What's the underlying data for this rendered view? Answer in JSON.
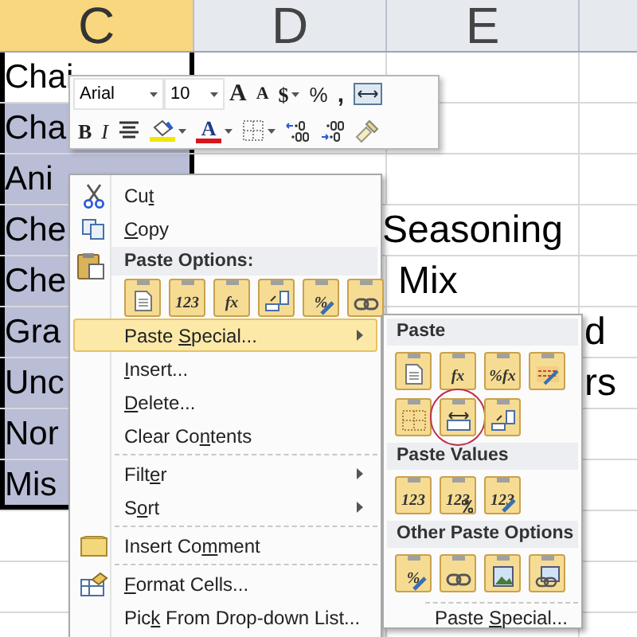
{
  "sheet": {
    "columns": [
      {
        "label": "C",
        "selected": true
      },
      {
        "label": "D",
        "selected": false
      },
      {
        "label": "E",
        "selected": false
      }
    ],
    "rows": [
      {
        "text": "Chai",
        "selected": false
      },
      {
        "text": "Cha",
        "selected": true
      },
      {
        "text": "Ani",
        "selected": true
      },
      {
        "text": "Che",
        "selected": true,
        "overflow": "Seasoning"
      },
      {
        "text": "Che",
        "selected": true,
        "overflow": "Mix"
      },
      {
        "text": "Gra",
        "selected": true,
        "overflow": "d"
      },
      {
        "text": "Unc",
        "selected": true,
        "overflow": "rs"
      },
      {
        "text": "Nor",
        "selected": true
      },
      {
        "text": "Mis",
        "selected": true
      }
    ]
  },
  "mini_toolbar": {
    "top_row": [
      {
        "kind": "font_field",
        "value": "Arial"
      },
      {
        "kind": "size_field",
        "value": "10"
      },
      {
        "kind": "grow",
        "glyph": "A"
      },
      {
        "kind": "shrink",
        "glyph": "A"
      },
      {
        "kind": "currency",
        "glyph": "$",
        "dropdown": true
      },
      {
        "kind": "percent",
        "glyph": "%"
      },
      {
        "kind": "comma",
        "glyph": ","
      },
      {
        "kind": "merge"
      }
    ],
    "bottom_row": [
      {
        "kind": "bold",
        "glyph": "B"
      },
      {
        "kind": "italic",
        "glyph": "I"
      },
      {
        "kind": "center"
      },
      {
        "kind": "fill",
        "color": "#f2e600",
        "dropdown": true
      },
      {
        "kind": "font_color",
        "glyph": "A",
        "color": "#d8141c",
        "dropdown": true
      },
      {
        "kind": "borders",
        "dropdown": true
      },
      {
        "kind": "inc_decimal"
      },
      {
        "kind": "dec_decimal"
      },
      {
        "kind": "painter"
      }
    ]
  },
  "context_menu": {
    "items": [
      {
        "kind": "item",
        "label": {
          "pre": "Cu",
          "key": "t"
        },
        "selected": false,
        "submenu": false
      },
      {
        "kind": "item",
        "label": {
          "key": "C",
          "post": "opy"
        },
        "selected": false,
        "submenu": false
      },
      {
        "kind": "header",
        "title": "Paste Options:"
      },
      {
        "kind": "icons",
        "icons": [
          {
            "kind": "page"
          },
          {
            "kind": "text",
            "glyph": "123"
          },
          {
            "kind": "text",
            "glyph": "fx"
          },
          {
            "kind": "transpose"
          },
          {
            "kind": "text_brush",
            "glyph": "%"
          },
          {
            "kind": "link"
          }
        ]
      },
      {
        "kind": "item",
        "label": {
          "pre": "Paste ",
          "key": "S",
          "post": "pecial..."
        },
        "selected": true,
        "submenu": true
      },
      {
        "kind": "item",
        "label": {
          "key": "I",
          "post": "nsert..."
        },
        "selected": false,
        "submenu": false
      },
      {
        "kind": "item",
        "label": {
          "key": "D",
          "post": "elete..."
        },
        "selected": false,
        "submenu": false
      },
      {
        "kind": "item",
        "label": {
          "pre": "Clear Co",
          "key": "n",
          "post": "tents"
        },
        "selected": false,
        "submenu": false
      },
      {
        "kind": "separator"
      },
      {
        "kind": "item",
        "label": {
          "pre": "Filt",
          "key": "e",
          "post": "r"
        },
        "selected": false,
        "submenu": true
      },
      {
        "kind": "item",
        "label": {
          "pre": "S",
          "key": "o",
          "post": "rt"
        },
        "selected": false,
        "submenu": true
      },
      {
        "kind": "separator"
      },
      {
        "kind": "item",
        "label": {
          "pre": "Insert Co",
          "key": "m",
          "post": "ment"
        },
        "selected": false,
        "submenu": false
      },
      {
        "kind": "separator"
      },
      {
        "kind": "item",
        "label": {
          "key": "F",
          "post": "ormat Cells..."
        },
        "selected": false,
        "submenu": false
      },
      {
        "kind": "item",
        "label": {
          "pre": "Pic",
          "key": "k",
          "post": " From Drop-down List..."
        },
        "selected": false,
        "submenu": false
      }
    ]
  },
  "paste_submenu": {
    "sections": [
      {
        "title": "Paste",
        "icons": [
          {
            "kind": "page",
            "circled": false
          },
          {
            "kind": "text",
            "glyph": "fx",
            "circled": false
          },
          {
            "kind": "text",
            "glyph": "%fx",
            "circled": false
          },
          {
            "kind": "brush",
            "circled": false
          },
          {
            "kind": "grid",
            "circled": false
          },
          {
            "kind": "widths",
            "circled": true
          },
          {
            "kind": "transpose",
            "circled": false
          }
        ]
      },
      {
        "title": "Paste Values",
        "icons": [
          {
            "kind": "text",
            "glyph": "123"
          },
          {
            "kind": "text_percent",
            "glyph": "123"
          },
          {
            "kind": "text_brush",
            "glyph": "123"
          }
        ]
      },
      {
        "title": "Other Paste Options",
        "icons": [
          {
            "kind": "text_brush",
            "glyph": "%"
          },
          {
            "kind": "link"
          },
          {
            "kind": "picture"
          },
          {
            "kind": "linked_picture"
          }
        ]
      }
    ],
    "footer": {
      "pre": "Paste ",
      "key": "S",
      "post": "pecial..."
    }
  }
}
